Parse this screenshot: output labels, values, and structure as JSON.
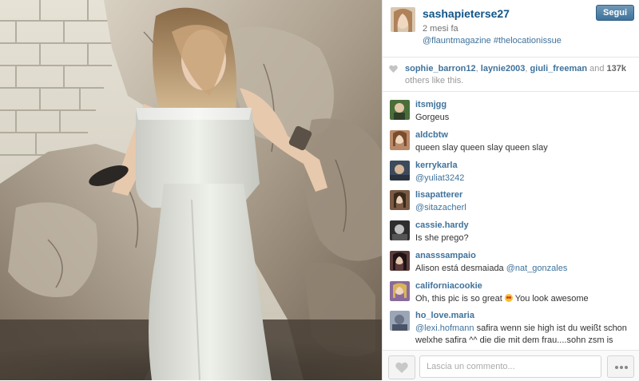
{
  "post": {
    "username": "sashapieterse27",
    "time_ago": "2 mesi fa",
    "caption": "@flauntmagazine #thelocationissue",
    "follow_label": "Segui"
  },
  "likes": {
    "users": [
      "sophie_barron12",
      "laynie2003",
      "giuli_freeman"
    ],
    "sep1": ", ",
    "sep2": ", ",
    "and_text": " and ",
    "count": "137k",
    "others_text": " others like this."
  },
  "comments": [
    {
      "user": "itsmjgg",
      "mention": "",
      "text": "Gorgeus",
      "avatar_color": "#4a6e3a"
    },
    {
      "user": "aldcbtw",
      "mention": "",
      "text": "queen slay queen slay queen slay",
      "avatar_color": "#b88a6a"
    },
    {
      "user": "kerrykarla",
      "mention": "@yuliat3242",
      "text": "",
      "avatar_color": "#3c4a5c"
    },
    {
      "user": "lisapatterer",
      "mention": "@sitazacherl",
      "text": "",
      "avatar_color": "#7a5a44"
    },
    {
      "user": "cassie.hardy",
      "mention": "",
      "text": "Is she prego?",
      "avatar_color": "#2e2e2e"
    },
    {
      "user": "anasssampaio",
      "mention": "@nat_gonzales",
      "text": "Alison está desmaiada ",
      "avatar_color": "#5a3a3a"
    },
    {
      "user": "californiacookie",
      "mention": "",
      "text": "Oh, this pic is so great",
      "text_after": " You look awesome",
      "emoji": "heart-eyes-emoji",
      "avatar_color": "#8a6a9a"
    },
    {
      "user": "ho_love.maria",
      "mention": "@lexi.hofmann",
      "text": " safira wenn sie high ist du weißt schon welxhe safira ^^ die die mit dem frau....sohn zsm is",
      "avatar_color": "#9aa6b8"
    }
  ],
  "footer": {
    "comment_placeholder": "Lascia un commento...",
    "like_icon": "heart-icon",
    "more_icon": "more-dots-icon"
  },
  "colors": {
    "link": "#3f729b",
    "username": "#125688",
    "follow_button": "#3f729b"
  }
}
